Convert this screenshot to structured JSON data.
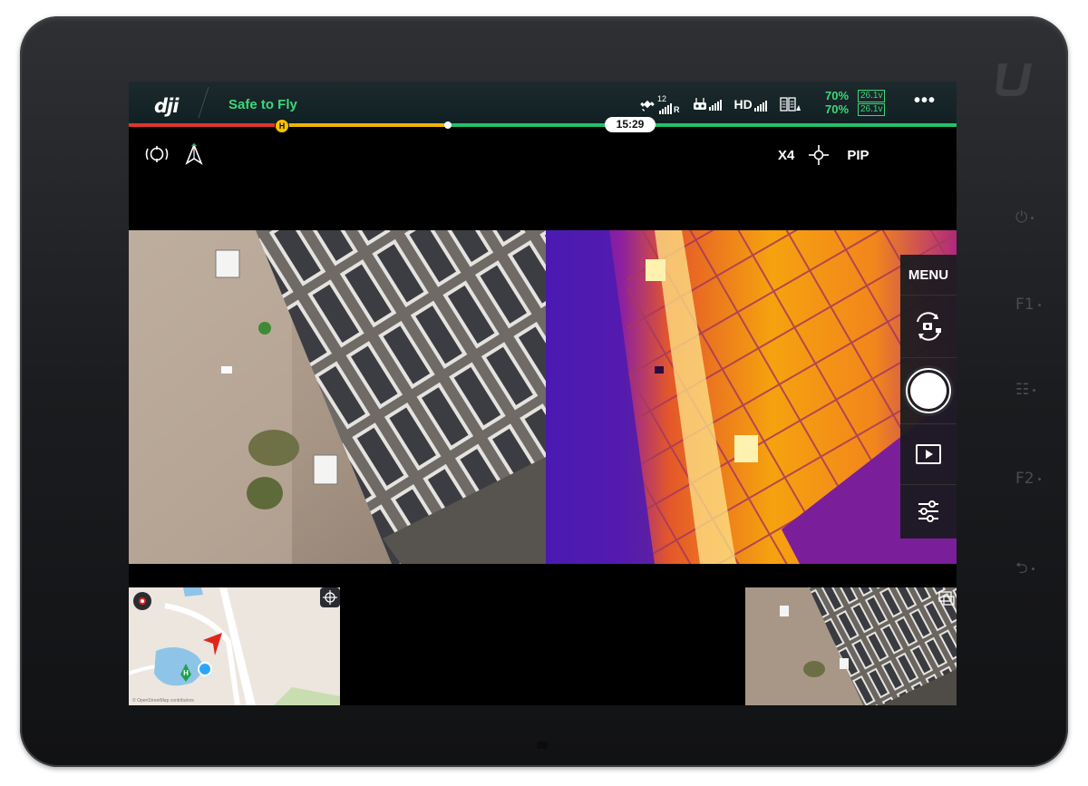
{
  "device": {
    "brand_mark": "U",
    "side_buttons": [
      "⏻",
      "F1",
      "☷",
      "F2",
      "⮌"
    ]
  },
  "statusbar": {
    "brand": "dji",
    "flight_status": "Safe to Fly",
    "gps_satellites": "12",
    "rc_signal_label": "R",
    "hd_label": "HD",
    "battery": [
      {
        "percent": "70%",
        "voltage": "26.1v"
      },
      {
        "percent": "70%",
        "voltage": "26.1v"
      }
    ],
    "more_label": "•••",
    "flight_time": "15:29",
    "home_marker": "H"
  },
  "camera": {
    "zoom": "X4",
    "pip_label": "PIP"
  },
  "side_menu": {
    "menu_label": "MENU"
  },
  "minimap": {
    "home_label": "H",
    "attribution": "© OpenStreetMap contributors"
  },
  "colors": {
    "safe": "#3fd67a",
    "battery": "#3fd67a",
    "progress_red": "#e0332f",
    "progress_yellow": "#f0b400",
    "progress_green": "#24c268",
    "aircraft_marker": "#e0251c",
    "location_dot": "#2ba6ff",
    "home_marker": "#1ea14a"
  },
  "icons": {
    "gps": "satellite-icon",
    "rc": "remote-controller-icon",
    "map": "map-icon",
    "switch_camera": "camera-switch-icon",
    "playback": "play-icon",
    "settings": "sliders-icon"
  }
}
